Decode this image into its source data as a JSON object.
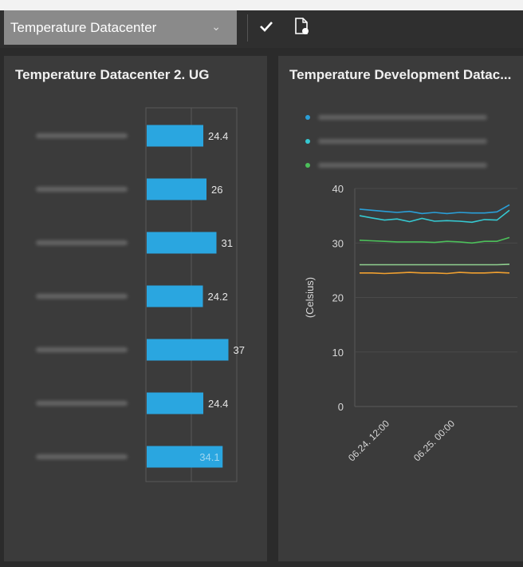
{
  "toolbar": {
    "dashboard_select": {
      "value": "Temperature Datacenter"
    },
    "chevron_icon": "chevron-down",
    "apply_icon": "check",
    "export_icon": "pdf-document"
  },
  "panels": [
    {
      "title": "Temperature Datacenter 2. UG",
      "chart_data": {
        "type": "bar",
        "orientation": "horizontal",
        "categories": [
          "",
          "",
          "",
          "",
          "",
          "",
          ""
        ],
        "values": [
          24.4,
          26,
          31,
          24.2,
          37,
          24.4,
          34.1
        ],
        "value_labels": [
          "24.4",
          "26",
          "31",
          "24.2",
          "37",
          "24.4",
          "34.1"
        ],
        "bar_color": "#2aa6e0"
      }
    },
    {
      "title": "Temperature Development Datac...",
      "chart_data": {
        "type": "line",
        "x_ticks": [
          "06.24. 12:00",
          "06.25. 00:00"
        ],
        "ylabel": "(Celsius)",
        "yticks": [
          0,
          10,
          20,
          30,
          40
        ],
        "ylim": [
          0,
          40
        ],
        "legend_position": "top",
        "series": [
          {
            "color": "#2a9fd8",
            "values": [
              36.2,
              36.0,
              35.8,
              35.6,
              35.8,
              35.4,
              35.6,
              35.4,
              35.6,
              35.5,
              35.5,
              35.7,
              37.0
            ]
          },
          {
            "color": "#35c9d2",
            "values": [
              35.0,
              34.6,
              34.2,
              34.4,
              33.9,
              34.5,
              34.0,
              34.1,
              34.0,
              33.8,
              34.3,
              34.2,
              36.0
            ]
          },
          {
            "color": "#4cbf5a",
            "values": [
              30.5,
              30.4,
              30.3,
              30.2,
              30.2,
              30.2,
              30.1,
              30.3,
              30.2,
              30.0,
              30.3,
              30.3,
              31.0
            ]
          },
          {
            "color": "#8fd08f",
            "values": [
              26.0,
              26.0,
              26.0,
              26.0,
              26.0,
              26.0,
              26.0,
              26.0,
              26.0,
              26.0,
              26.0,
              26.0,
              26.1
            ]
          },
          {
            "color": "#f0a030",
            "values": [
              24.5,
              24.5,
              24.4,
              24.5,
              24.6,
              24.5,
              24.5,
              24.4,
              24.6,
              24.5,
              24.5,
              24.6,
              24.5
            ]
          }
        ]
      }
    }
  ]
}
